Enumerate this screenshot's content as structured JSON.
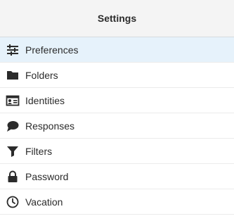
{
  "header": {
    "title": "Settings"
  },
  "menu": {
    "selected_index": 0,
    "items": [
      {
        "label": "Preferences",
        "icon": "sliders-icon"
      },
      {
        "label": "Folders",
        "icon": "folder-icon"
      },
      {
        "label": "Identities",
        "icon": "id-card-icon"
      },
      {
        "label": "Responses",
        "icon": "speech-bubble-icon"
      },
      {
        "label": "Filters",
        "icon": "filter-icon"
      },
      {
        "label": "Password",
        "icon": "lock-icon"
      },
      {
        "label": "Vacation",
        "icon": "clock-icon"
      }
    ]
  },
  "colors": {
    "selected_background": "#e6f2fb",
    "header_background": "#f4f4f4",
    "text": "#2b2b2b",
    "icon": "#2b2b2b"
  }
}
